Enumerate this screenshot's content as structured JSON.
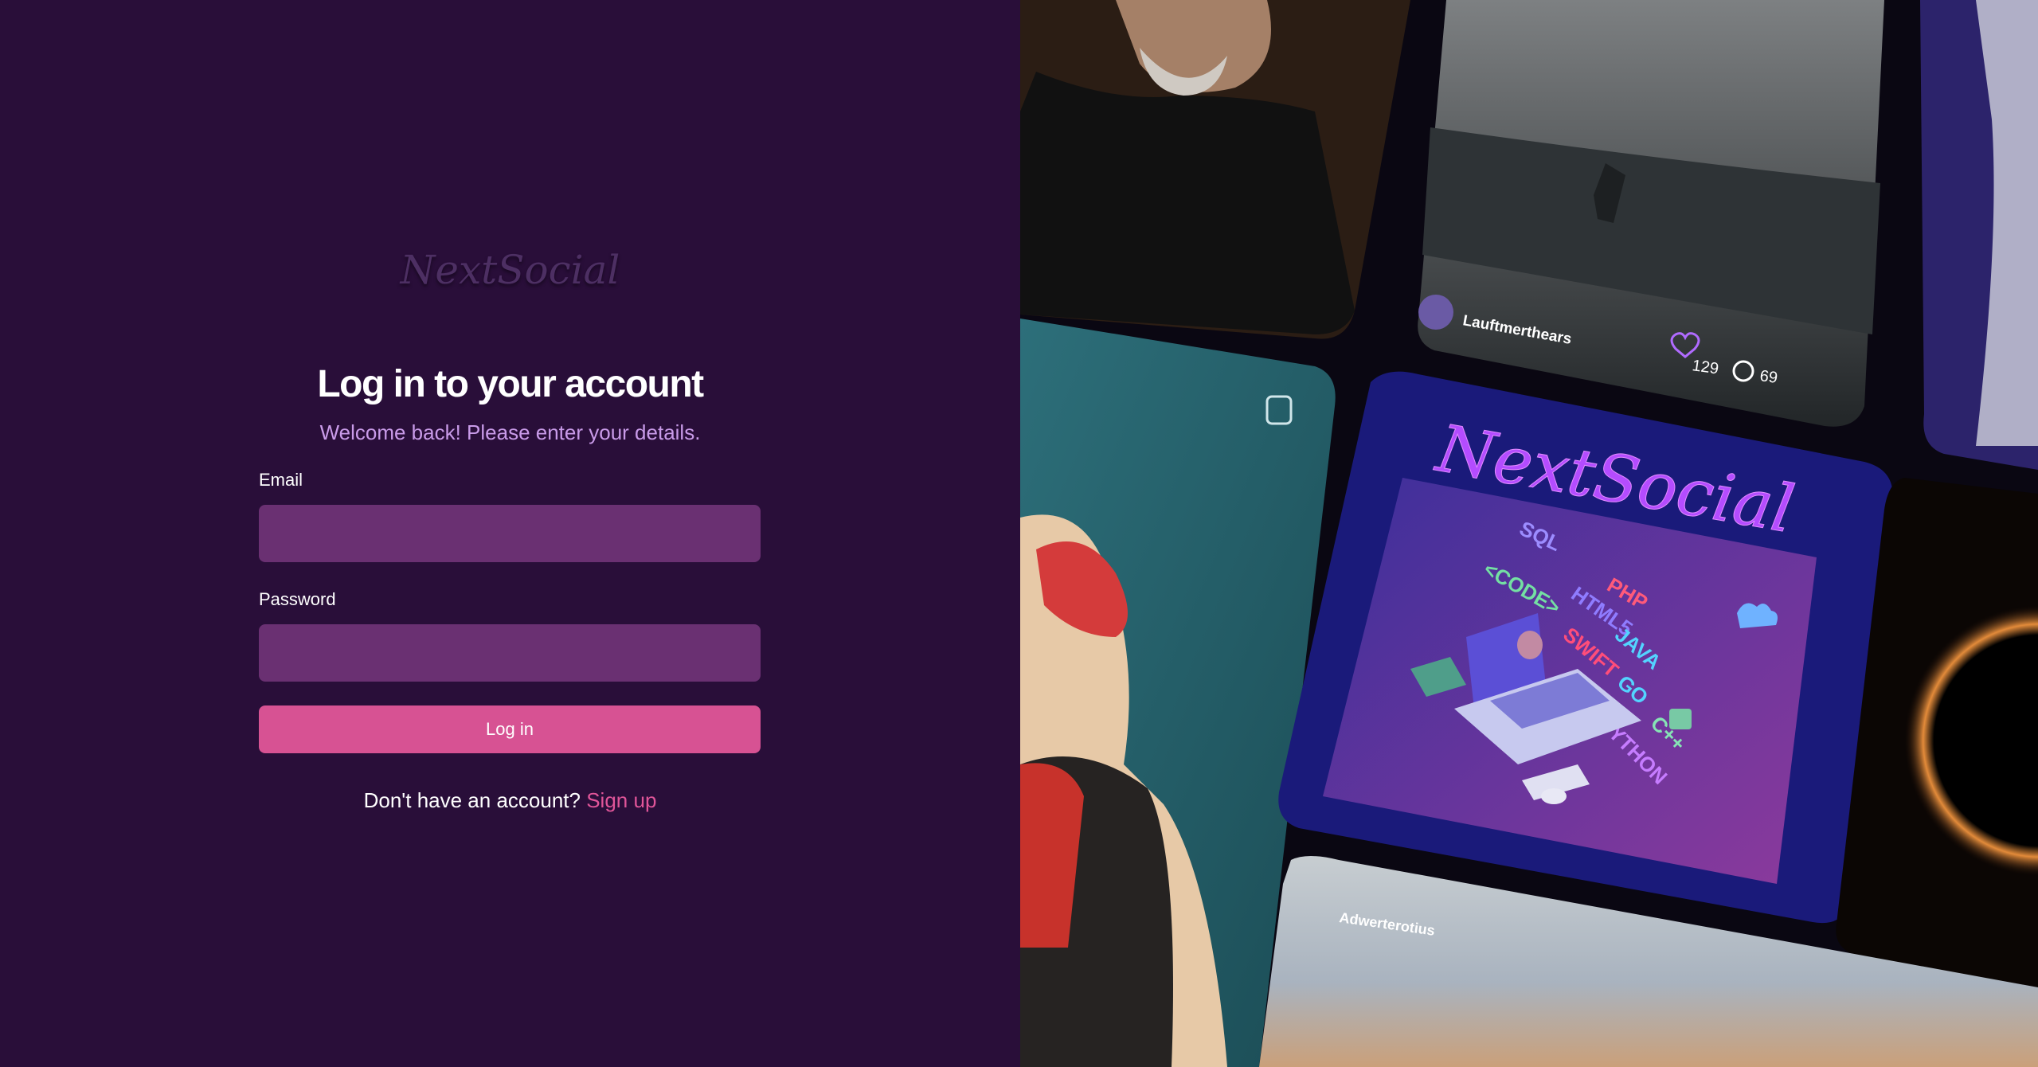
{
  "brand": {
    "logo_text": "NextSocial"
  },
  "login": {
    "title": "Log in to your account",
    "subtitle": "Welcome back! Please enter your details.",
    "email_label": "Email",
    "email_value": "",
    "password_label": "Password",
    "password_value": "",
    "submit_label": "Log in",
    "signup_prompt": "Don't have an account?",
    "signup_link": "Sign up"
  },
  "collage": {
    "post_username": "Lauftmerthears",
    "likes": "129",
    "comments": "69",
    "banner_logo": "NextSocial",
    "code_words": [
      "SQL",
      "PHP",
      "<CODE>",
      "HTML5",
      "SWIFT",
      "JAVA",
      "GO",
      "PYTHON",
      "C++"
    ],
    "bottom_card_caption": "Adwerterotius",
    "colors": {
      "accent": "#d75293",
      "background": "#290e39",
      "input": "#6a3072"
    }
  }
}
